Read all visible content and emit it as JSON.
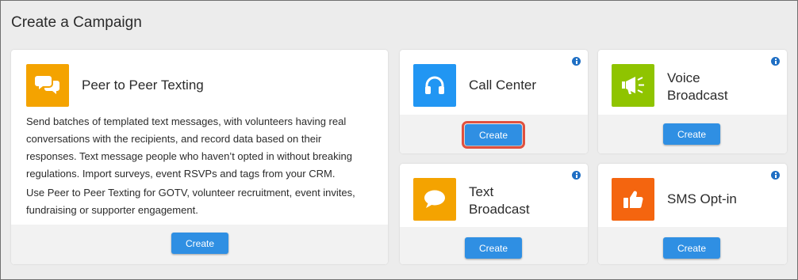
{
  "page": {
    "title": "Create a Campaign"
  },
  "colors": {
    "orange": "#f4a300",
    "blue": "#2196f3",
    "lime": "#8fc400",
    "deep_orange": "#f4650f",
    "button": "#2f8fe3",
    "info": "#1f6fc4",
    "highlight": "#e0513f"
  },
  "cards": {
    "peer": {
      "title": "Peer to Peer Texting",
      "icon": "chat-bubbles-icon",
      "description_1": "Send batches of templated text messages, with volunteers having real conversations with the recipients, and record data based on their responses. Text message people who haven’t opted in without breaking regulations. Import surveys, event RSVPs and tags from your CRM.",
      "description_2": "Use Peer to Peer Texting for GOTV, volunteer recruitment, event invites, fundraising or supporter engagement.",
      "button": "Create"
    },
    "call_center": {
      "title": "Call Center",
      "icon": "headphones-icon",
      "button": "Create"
    },
    "voice_broadcast": {
      "title": "Voice\nBroadcast",
      "icon": "megaphone-icon",
      "button": "Create"
    },
    "text_broadcast": {
      "title": "Text\nBroadcast",
      "icon": "speech-bubble-icon",
      "button": "Create"
    },
    "sms_optin": {
      "title": "SMS Opt-in",
      "icon": "thumbs-up-icon",
      "button": "Create"
    }
  }
}
